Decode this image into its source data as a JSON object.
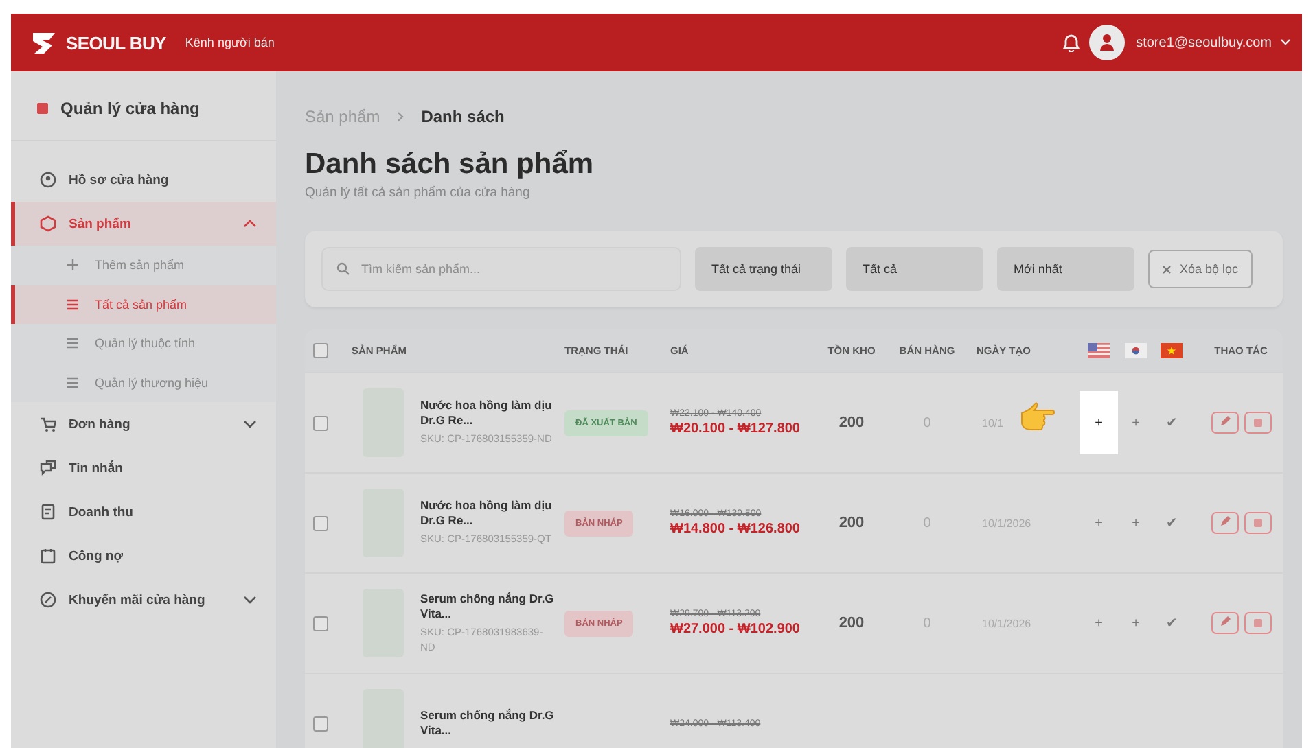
{
  "topbar": {
    "brand": "SEOUL BUY",
    "subtitle": "Kênh người bán",
    "user_email": "store1@seoulbuy.com"
  },
  "sidebar": {
    "title": "Quản lý cửa hàng",
    "items": [
      {
        "label": "Hồ sơ cửa hàng",
        "selected": false
      },
      {
        "label": "Sản phẩm",
        "selected": true,
        "expanded": true,
        "children": [
          {
            "label": "Thêm sản phẩm",
            "selected": false
          },
          {
            "label": "Tất cả sản phẩm",
            "selected": true
          },
          {
            "label": "Quản lý thuộc tính",
            "selected": false
          },
          {
            "label": "Quản lý thương hiệu",
            "selected": false
          }
        ]
      },
      {
        "label": "Đơn hàng",
        "selected": false,
        "expanded": false
      },
      {
        "label": "Tin nhắn",
        "selected": false
      },
      {
        "label": "Doanh thu",
        "selected": false
      },
      {
        "label": "Công nợ",
        "selected": false
      },
      {
        "label": "Khuyến mãi cửa hàng",
        "selected": false,
        "expanded": false
      }
    ]
  },
  "breadcrumb": [
    "Sản phẩm",
    "Danh sách"
  ],
  "page_title": "Danh sách sản phẩm",
  "page_subtitle": "Quản lý tất cả sản phẩm của cửa hàng",
  "filters": {
    "search": {
      "placeholder": "Tìm kiếm sản phẩm..."
    },
    "selects": [
      "Tất cả trạng thái",
      "Tất cả",
      "Mới nhất"
    ],
    "clear_button": "Xóa bộ lọc"
  },
  "table": {
    "select_all_checked": false,
    "columns": [
      "SẢN PHẨM",
      "TRẠNG THÁI",
      "GIÁ",
      "TỒN KHO",
      "BÁN HÀNG",
      "NGÀY TẠO",
      "THAO TÁC"
    ],
    "rows": [
      {
        "checked": false,
        "name": "Nước hoa hồng làm dịu Dr.G Re...",
        "sku": "SKU: CP-176803155359-ND",
        "status": {
          "label": "ĐÃ XUẤT BẢN",
          "kind": "published"
        },
        "old_price": "₩22.100 - ₩140.400",
        "price": "₩20.100 - ₩127.800",
        "stock": "200",
        "sold": "0",
        "date": "10/1",
        "translations": [
          {
            "mark": "+",
            "highlighted": true
          },
          {
            "mark": "+",
            "highlighted": false
          },
          {
            "mark": "✔",
            "highlighted": false
          }
        ]
      },
      {
        "checked": false,
        "name": "Nước hoa hồng làm dịu Dr.G Re...",
        "sku": "SKU: CP-176803155359-QT",
        "status": {
          "label": "BẢN NHÁP",
          "kind": "draft"
        },
        "old_price": "₩16.000 - ₩139.500",
        "price": "₩14.800 - ₩126.800",
        "stock": "200",
        "sold": "0",
        "date": "10/1/2026",
        "translations": [
          {
            "mark": "+",
            "highlighted": false
          },
          {
            "mark": "+",
            "highlighted": false
          },
          {
            "mark": "✔",
            "highlighted": false
          }
        ]
      },
      {
        "checked": false,
        "name": "Serum chống nắng Dr.G Vita...",
        "sku": "SKU: CP-1768031983639-ND",
        "status": {
          "label": "BẢN NHÁP",
          "kind": "draft"
        },
        "old_price": "₩29.700 - ₩113.200",
        "price": "₩27.000 - ₩102.900",
        "stock": "200",
        "sold": "0",
        "date": "10/1/2026",
        "translations": [
          {
            "mark": "+",
            "highlighted": false
          },
          {
            "mark": "+",
            "highlighted": false
          },
          {
            "mark": "✔",
            "highlighted": false
          }
        ]
      },
      {
        "checked": false,
        "name": "Serum chống nắng Dr.G Vita...",
        "old_price": "₩24.000 - ₩113.400"
      }
    ]
  }
}
